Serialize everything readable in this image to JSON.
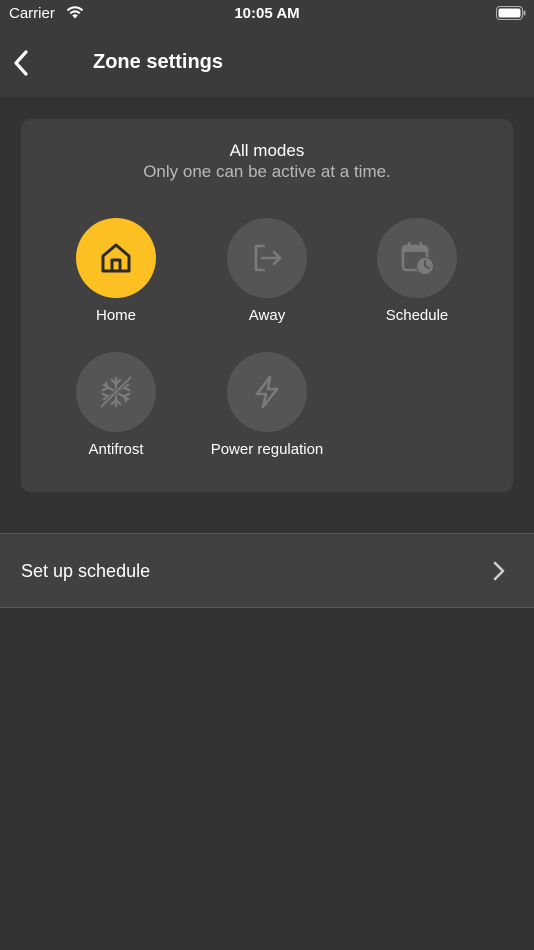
{
  "status_bar": {
    "carrier": "Carrier",
    "time": "10:05 AM"
  },
  "nav": {
    "title": "Zone settings",
    "back_icon": "chevron-left-icon"
  },
  "modes_card": {
    "title": "All modes",
    "subtitle": "Only one can be active at a time.",
    "active_mode": "Home",
    "modes": [
      {
        "label": "Home",
        "icon": "home-icon",
        "active": true
      },
      {
        "label": "Away",
        "icon": "logout-icon",
        "active": false
      },
      {
        "label": "Schedule",
        "icon": "calendar-clock-icon",
        "active": false
      },
      {
        "label": "Antifrost",
        "icon": "snowflake-icon",
        "active": false
      },
      {
        "label": "Power regulation",
        "icon": "lightning-icon",
        "active": false
      }
    ]
  },
  "schedule_row": {
    "label": "Set up schedule",
    "icon": "chevron-right-icon"
  },
  "colors": {
    "background": "#333333",
    "card": "#414141",
    "accent": "#fcc022",
    "inactive_circle": "#555555",
    "subtitle_text": "#b8b8b8"
  }
}
